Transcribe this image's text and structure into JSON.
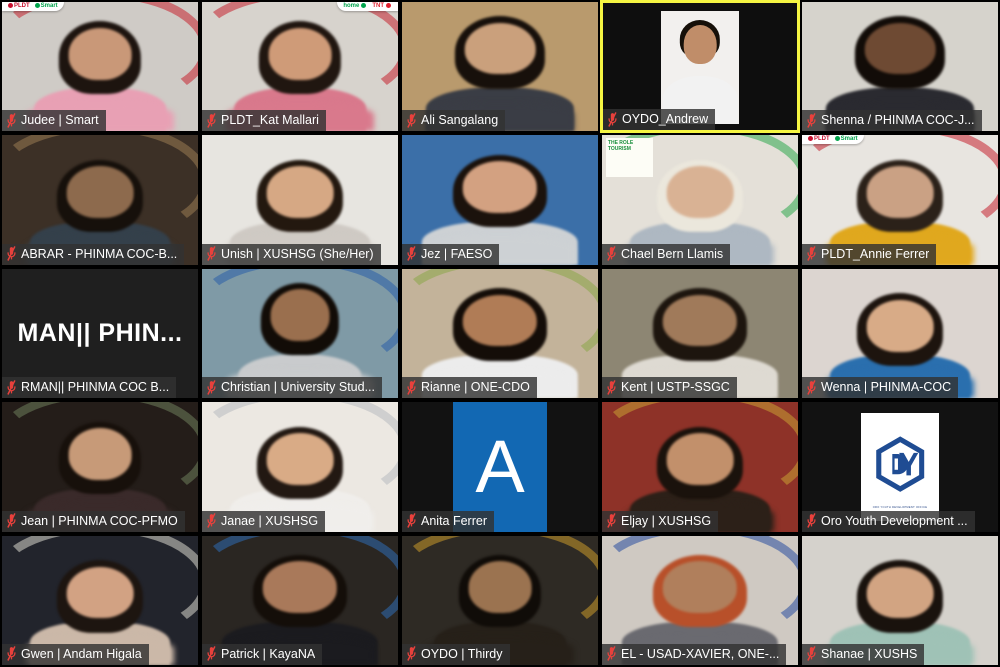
{
  "app": {
    "view": "gallery",
    "rows": 5,
    "cols": 5,
    "mic_icon": "microphone-muted-icon",
    "active_speaker_border_color": "#f5f542",
    "active_speaker_inner_color": "#4ef531",
    "namebar_bg": "#323232",
    "mic_color": "#e8413c"
  },
  "brands": {
    "pldt": "PLDT",
    "smart": "Smart",
    "home": "home",
    "tnt": "TNT"
  },
  "participants": [
    {
      "id": "judee-smart",
      "name": "Judee | Smart",
      "row": 1,
      "col": 1,
      "muted": true,
      "active_speaker": false,
      "camera": "on",
      "badge": "pldt-smart",
      "badge_side": "left",
      "bg": "#cfcbc6",
      "skin": "#c99878",
      "hair": "#1d140f",
      "shirt": "#e8a0b4",
      "accent": "#c62430"
    },
    {
      "id": "pldt-kat-mallari",
      "name": "PLDT_Kat Mallari",
      "row": 1,
      "col": 2,
      "muted": true,
      "active_speaker": false,
      "camera": "on",
      "badge": "home-tnt",
      "badge_side": "right",
      "bg": "#d7d3cd",
      "skin": "#cf9b78",
      "hair": "#201610",
      "shirt": "#d9798c",
      "accent": "#c62430"
    },
    {
      "id": "ali-sangalang",
      "name": "Ali Sangalang",
      "row": 1,
      "col": 3,
      "muted": true,
      "active_speaker": false,
      "camera": "on",
      "badge": null,
      "bg": "#b99a6d",
      "skin": "#caa07c",
      "hair": "#17100b",
      "shirt": "#3a3d45",
      "accent": null
    },
    {
      "id": "oydo-andrew",
      "name": "OYDO_Andrew",
      "row": 1,
      "col": 4,
      "muted": true,
      "active_speaker": true,
      "camera": "on",
      "badge": null,
      "bg": "#0e0e0e",
      "inner_bg": "#f2f0ee",
      "skin": "#c08d69",
      "hair": "#161009",
      "shirt": "#f2f2f2",
      "accent": null
    },
    {
      "id": "shenna-phinma",
      "name": "Shenna / PHINMA COC-J...",
      "row": 1,
      "col": 5,
      "muted": true,
      "active_speaker": false,
      "camera": "on",
      "badge": null,
      "bg": "#d6d3cc",
      "skin": "#6e4a33",
      "hair": "#120c08",
      "shirt": "#2a2a30",
      "accent": null
    },
    {
      "id": "abrar-phinma",
      "name": "ABRAR - PHINMA COC-B...",
      "row": 2,
      "col": 1,
      "muted": true,
      "active_speaker": false,
      "camera": "on",
      "badge": null,
      "bg": "#3c3026",
      "skin": "#8d6a4d",
      "hair": "#16100b",
      "shirt": "#34404b",
      "accent": "#9a7b52"
    },
    {
      "id": "unish-xushsg",
      "name": "Unish | XUSHSG (She/Her)",
      "row": 2,
      "col": 2,
      "muted": true,
      "active_speaker": false,
      "camera": "on",
      "badge": null,
      "bg": "#e7e5e0",
      "skin": "#d6a884",
      "hair": "#23180f",
      "shirt": "#cfcac4",
      "accent": null
    },
    {
      "id": "jez-faeso",
      "name": "Jez | FAESO",
      "row": 2,
      "col": 3,
      "muted": true,
      "active_speaker": false,
      "camera": "on",
      "badge": null,
      "bg": "#3b6fa8",
      "skin": "#d3a181",
      "hair": "#1b120c",
      "shirt": "#cdd1d4",
      "accent": null
    },
    {
      "id": "chael-bern-llamis",
      "name": "Chael Bern Llamis",
      "row": 2,
      "col": 4,
      "muted": true,
      "active_speaker": false,
      "camera": "on",
      "badge": null,
      "bg": "#e4e0d8",
      "skin": "#d9b294",
      "hair": "#ebe7dc",
      "shirt": "#aeb8c2",
      "accent": "#2fa84f",
      "poster_text": "THE ROLE TOURISM"
    },
    {
      "id": "pldt-annie-ferrer",
      "name": "PLDT_Annie Ferrer",
      "row": 2,
      "col": 5,
      "muted": true,
      "active_speaker": false,
      "camera": "on",
      "badge": "pldt-smart",
      "badge_side": "left",
      "bg": "#e8e5e0",
      "skin": "#caa184",
      "hair": "#2b2119",
      "shirt": "#e0a81e",
      "accent": "#c62430"
    },
    {
      "id": "rman-phinma",
      "name": "RMAN|| PHINMA COC B...",
      "display_text": "MAN||  PHIN...",
      "row": 3,
      "col": 1,
      "muted": true,
      "active_speaker": false,
      "camera": "off",
      "badge": null,
      "bg": "#1f1f1f"
    },
    {
      "id": "christian-university-stud",
      "name": "Christian | University Stud...",
      "row": 3,
      "col": 2,
      "muted": true,
      "active_speaker": false,
      "camera": "on",
      "badge": null,
      "bg": "#7f9aa6",
      "skin": "#9a6f4e",
      "hair": "#120c07",
      "shirt": "#c9cbcd",
      "accent": "#2a5fa8",
      "virtual_bg": "USTP campus"
    },
    {
      "id": "rianne-one-cdo",
      "name": "Rianne | ONE-CDO",
      "row": 3,
      "col": 3,
      "muted": true,
      "active_speaker": false,
      "camera": "on",
      "badge": null,
      "bg": "#c3b39a",
      "skin": "#b07c56",
      "hair": "#140d08",
      "shirt": "#ececec",
      "accent": "#8ca84a"
    },
    {
      "id": "kent-ustp-ssgc",
      "name": "Kent | USTP-SSGC",
      "row": 3,
      "col": 4,
      "muted": true,
      "active_speaker": false,
      "camera": "on",
      "badge": null,
      "bg": "#8d8673",
      "skin": "#a07a5a",
      "hair": "#1d150e",
      "shirt": "#dedad2",
      "accent": null
    },
    {
      "id": "wenna-phinma",
      "name": "Wenna | PHINMA-COC",
      "row": 3,
      "col": 5,
      "muted": true,
      "active_speaker": false,
      "camera": "on",
      "badge": null,
      "bg": "#dcd5d0",
      "skin": "#d8ab87",
      "hair": "#1d140e",
      "shirt": "#2a6fae",
      "accent": null
    },
    {
      "id": "jean-phinma-pfmo",
      "name": "Jean | PHINMA COC-PFMO",
      "row": 4,
      "col": 1,
      "muted": true,
      "active_speaker": false,
      "camera": "on",
      "badge": null,
      "bg": "#241d19",
      "skin": "#c79a78",
      "hair": "#17100b",
      "shirt": "#3a2a2a",
      "accent": "#6e7e5c"
    },
    {
      "id": "janae-xushsg",
      "name": "Janae | XUSHSG",
      "row": 4,
      "col": 2,
      "muted": true,
      "active_speaker": false,
      "camera": "on",
      "badge": null,
      "bg": "#ece8e2",
      "skin": "#d9ab86",
      "hair": "#221812",
      "shirt": "#f0eeeb",
      "accent": "#b9bcc0"
    },
    {
      "id": "anita-ferrer",
      "name": "Anita Ferrer",
      "row": 4,
      "col": 3,
      "muted": true,
      "active_speaker": false,
      "camera": "off",
      "avatar_letter": "A",
      "avatar_color": "#1268b3",
      "badge": null,
      "bg": "#121212"
    },
    {
      "id": "eljay-xushsg",
      "name": "Eljay | XUSHSG",
      "row": 4,
      "col": 4,
      "muted": true,
      "active_speaker": false,
      "camera": "on",
      "badge": null,
      "bg": "#8e3228",
      "skin": "#c2906b",
      "hair": "#1a120c",
      "shirt": "#2c2018",
      "accent": "#c9a033"
    },
    {
      "id": "oro-youth-development",
      "name": "Oro Youth Development ...",
      "row": 4,
      "col": 5,
      "muted": true,
      "active_speaker": false,
      "camera": "off",
      "logo": "oydo-hexagon-logo",
      "logo_color": "#1f4c93",
      "logo_caption": "ORO YOUTH DEVELOPMENT OFFICE",
      "badge": null,
      "bg": "#121212"
    },
    {
      "id": "gwen-andam-higala",
      "name": "Gwen | Andam Higala",
      "row": 5,
      "col": 1,
      "muted": true,
      "active_speaker": false,
      "camera": "on",
      "badge": null,
      "bg": "#22242c",
      "skin": "#d2a283",
      "hair": "#1d1510",
      "shirt": "#cbb8a8",
      "accent": "#d9d6cc"
    },
    {
      "id": "patrick-kayana",
      "name": "Patrick | KayaNA",
      "row": 5,
      "col": 2,
      "muted": true,
      "active_speaker": false,
      "camera": "on",
      "badge": null,
      "bg": "#2a2622",
      "skin": "#a9795a",
      "hair": "#140e09",
      "shirt": "#1b1b1f",
      "accent": "#2f6cb5"
    },
    {
      "id": "oydo-thirdy",
      "name": "OYDO | Thirdy",
      "row": 5,
      "col": 3,
      "muted": true,
      "active_speaker": false,
      "camera": "on",
      "badge": null,
      "bg": "#2e2a24",
      "skin": "#9b7350",
      "hair": "#100c08",
      "shirt": "#262019",
      "accent": "#c99a2a"
    },
    {
      "id": "el-usad-xavier",
      "name": "EL - USAD-XAVIER, ONE-...",
      "row": 5,
      "col": 4,
      "muted": true,
      "active_speaker": false,
      "camera": "on",
      "badge": null,
      "bg": "#cfc9c2",
      "skin": "#b07f5c",
      "hair": "#b8502a",
      "shirt": "#6a6a70",
      "accent": "#2a4fa0"
    },
    {
      "id": "shanae-xushs",
      "name": "Shanae | XUSHS",
      "row": 5,
      "col": 5,
      "muted": true,
      "active_speaker": false,
      "camera": "on",
      "badge": null,
      "bg": "#d5d2cc",
      "skin": "#d2a482",
      "hair": "#19120d",
      "shirt": "#9fc2b6",
      "accent": null
    }
  ]
}
